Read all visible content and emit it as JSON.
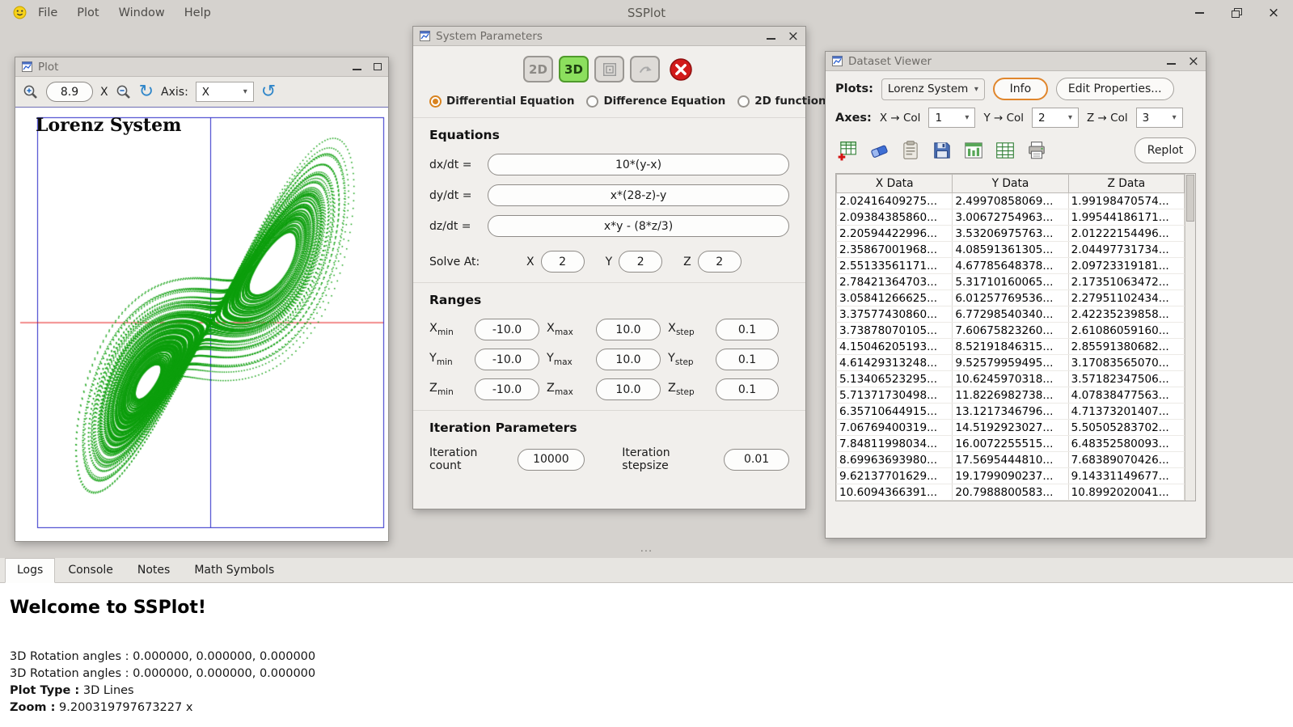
{
  "app": {
    "title": "SSPlot",
    "menu": [
      "File",
      "Plot",
      "Window",
      "Help"
    ]
  },
  "icons": {
    "close": "×",
    "caret": "▾",
    "rotate_cw": "↻",
    "rotate_ccw": "↺",
    "splitter_dots": "···"
  },
  "plot_window": {
    "title": "Plot",
    "zoom_value": "8.9",
    "zoom_x_label": "X",
    "axis_label": "Axis:",
    "axis_value": "X",
    "chart_title": "Lorenz System"
  },
  "system_parameters": {
    "title": "System Parameters",
    "mode_2d": "2D",
    "mode_3d": "3D",
    "radios": [
      "Differential Equation",
      "Difference Equation",
      "2D function"
    ],
    "selected_radio": "Differential Equation",
    "equations_heading": "Equations",
    "equations": [
      {
        "label": "dx/dt =",
        "value": "10*(y-x)"
      },
      {
        "label": "dy/dt =",
        "value": "x*(28-z)-y"
      },
      {
        "label": "dz/dt =",
        "value": "x*y - (8*z/3)"
      }
    ],
    "solve_at_label": "Solve At:",
    "solve_at": [
      {
        "axis": "X",
        "value": "2"
      },
      {
        "axis": "Y",
        "value": "2"
      },
      {
        "axis": "Z",
        "value": "2"
      }
    ],
    "ranges_heading": "Ranges",
    "sub_labels": {
      "min": "min",
      "max": "max",
      "step": "step"
    },
    "ranges": [
      {
        "base": "X",
        "min": "-10.0",
        "max": "10.0",
        "step": "0.1"
      },
      {
        "base": "Y",
        "min": "-10.0",
        "max": "10.0",
        "step": "0.1"
      },
      {
        "base": "Z",
        "min": "-10.0",
        "max": "10.0",
        "step": "0.1"
      }
    ],
    "iteration_heading": "Iteration Parameters",
    "iteration_count_label": "Iteration count",
    "iteration_count": "10000",
    "iteration_stepsize_label": "Iteration stepsize",
    "iteration_stepsize": "0.01"
  },
  "dataset_viewer": {
    "title": "Dataset Viewer",
    "plots_label": "Plots:",
    "plot_name": "Lorenz System",
    "info_button": "Info",
    "edit_properties_button": "Edit Properties...",
    "axes_label": "Axes:",
    "x_col_label": "X → Col",
    "x_col": "1",
    "y_col_label": "Y → Col",
    "y_col": "2",
    "z_col_label": "Z → Col",
    "z_col": "3",
    "replot_button": "Replot",
    "table": {
      "headers": [
        "X Data",
        "Y Data",
        "Z Data"
      ],
      "rows": [
        [
          "2.02416409275...",
          "2.49970858069...",
          "1.99198470574..."
        ],
        [
          "2.09384385860...",
          "3.00672754963...",
          "1.99544186171..."
        ],
        [
          "2.20594422996...",
          "3.53206975763...",
          "2.01222154496..."
        ],
        [
          "2.35867001968...",
          "4.08591361305...",
          "2.04497731734..."
        ],
        [
          "2.55133561171...",
          "4.67785648378...",
          "2.09723319181..."
        ],
        [
          "2.78421364703...",
          "5.31710160065...",
          "2.17351063472..."
        ],
        [
          "3.05841266625...",
          "6.01257769536...",
          "2.27951102434..."
        ],
        [
          "3.37577430860...",
          "6.77298540340...",
          "2.42235239858..."
        ],
        [
          "3.73878070105...",
          "7.60675823260...",
          "2.61086059160..."
        ],
        [
          "4.15046205193...",
          "8.52191846315...",
          "2.85591380682..."
        ],
        [
          "4.61429313248...",
          "9.52579959495...",
          "3.17083565070..."
        ],
        [
          "5.13406523295...",
          "10.6245970318...",
          "3.57182347506..."
        ],
        [
          "5.71371730498...",
          "11.8226982738...",
          "4.07838477563..."
        ],
        [
          "6.35710644915...",
          "13.1217346796...",
          "4.71373201407..."
        ],
        [
          "7.06769400319...",
          "14.5192923027...",
          "5.50505283702..."
        ],
        [
          "7.84811998034...",
          "16.0072255515...",
          "6.48352580093..."
        ],
        [
          "8.69963693980...",
          "17.5695444810...",
          "7.68389070426..."
        ],
        [
          "9.62137701629...",
          "19.1799090237...",
          "9.14331149677..."
        ],
        [
          "10.6094366391...",
          "20.7988800583...",
          "10.8992020041..."
        ]
      ]
    }
  },
  "bottom_panel": {
    "tabs": [
      "Logs",
      "Console",
      "Notes",
      "Math Symbols"
    ],
    "active_tab": "Logs",
    "welcome": "Welcome to SSPlot!",
    "log_lines": [
      {
        "bold": "",
        "text": "3D Rotation angles : 0.000000, 0.000000, 0.000000"
      },
      {
        "bold": "",
        "text": "3D Rotation angles : 0.000000, 0.000000, 0.000000"
      },
      {
        "bold": "Plot Type :",
        "text": " 3D Lines"
      },
      {
        "bold": "Zoom :",
        "text": " 9.200319797673227 x"
      }
    ]
  },
  "chart_data": {
    "type": "scatter",
    "title": "Lorenz System",
    "equations": [
      "dx/dt = 10*(y-x)",
      "dy/dt = x*(28-z)-y",
      "dz/dt = x*y - (8*z/3)"
    ],
    "sigma": 10,
    "rho": 28,
    "beta": 2.6666666667,
    "dt": 0.01,
    "steps": 10000,
    "start": [
      2,
      2,
      2
    ],
    "projection": "x-y",
    "zoom": 9.200319797673227,
    "point_color": "#0d9f0d",
    "box_color": "#2828c8",
    "hline_color": "#e51818"
  }
}
